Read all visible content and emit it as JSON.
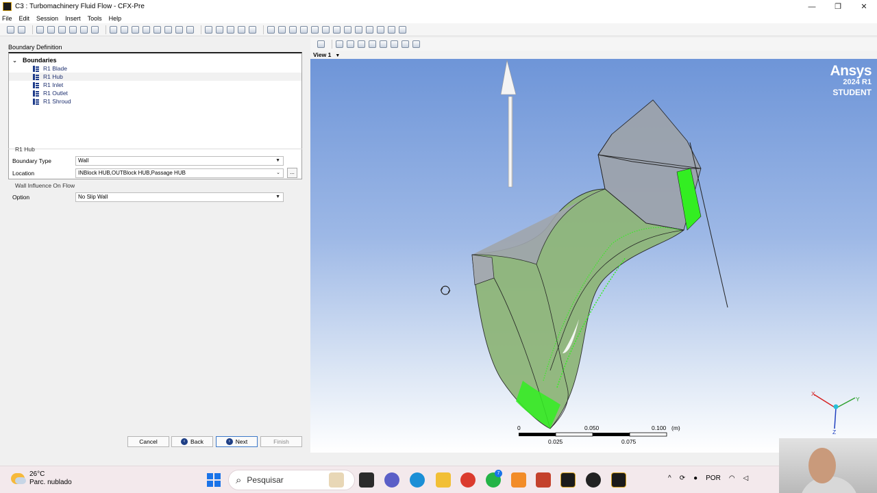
{
  "window": {
    "title": "C3 : Turbomachinery Fluid Flow - CFX-Pre",
    "minimize": "—",
    "maximize": "❐",
    "close": "✕"
  },
  "menu": [
    "File",
    "Edit",
    "Session",
    "Insert",
    "Tools",
    "Help"
  ],
  "left_panel": {
    "heading": "Boundary Definition",
    "tree_root": "Boundaries",
    "tree_items": [
      "R1 Blade",
      "R1 Hub",
      "R1 Inlet",
      "R1 Outlet",
      "R1 Shroud"
    ],
    "selected_item": "R1 Hub",
    "group_title": "R1 Hub",
    "boundary_type_label": "Boundary Type",
    "boundary_type_value": "Wall",
    "location_label": "Location",
    "location_value": "INBlock HUB,OUTBlock HUB,Passage HUB",
    "location_button": "...",
    "wall_influence_title": "Wall Influence On Flow",
    "option_label": "Option",
    "option_value": "No Slip Wall"
  },
  "buttons": {
    "cancel": "Cancel",
    "back": "Back",
    "next": "Next",
    "finish": "Finish"
  },
  "viewport": {
    "view_tab": "View 1",
    "brand_name": "Ansys",
    "brand_version": "2024 R1",
    "brand_edition": "STUDENT",
    "scale_top": [
      "0",
      "0.050",
      "0.100",
      "(m)"
    ],
    "scale_bottom": [
      "0.025",
      "0.075"
    ],
    "axes": [
      "X",
      "Y",
      "Z"
    ]
  },
  "taskbar": {
    "temperature": "26°C",
    "weather": "Parc. nublado",
    "search_placeholder": "Pesquisar",
    "language": "POR",
    "chat_badge": "7"
  },
  "colors": {
    "viewport_top": "#6e95d8",
    "viewport_bottom": "#ffffff",
    "mesh_green": "#33ee22",
    "brand_text": "#ffffff"
  }
}
